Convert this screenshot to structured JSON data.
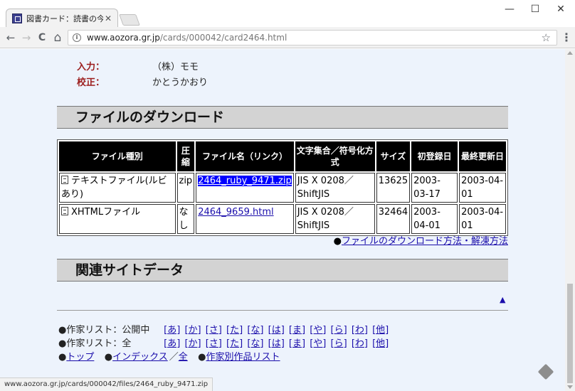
{
  "browser": {
    "tab_title": "図書カード：読書の今昔",
    "tab_close": "✕",
    "url_host": "www.aozora.gr.jp",
    "url_path": "/cards/000042/card2464.html",
    "status_url": "www.aozora.gr.jp/cards/000042/files/2464_ruby_9471.zip",
    "minimize": "—",
    "maximize": "☐",
    "close": "✕",
    "back": "←",
    "forward": "→",
    "reload": "C",
    "home": "⌂",
    "info": "i",
    "star": "☆",
    "menu": "⋮"
  },
  "meta": [
    {
      "label": "入力：",
      "value": "（株）モモ"
    },
    {
      "label": "校正：",
      "value": "かとうかおり"
    }
  ],
  "download_section": {
    "title": "ファイルのダウンロード",
    "headers": {
      "type": "ファイル種別",
      "compress": "圧縮",
      "name": "ファイル名（リンク）",
      "charset": "文字集合／符号化方式",
      "size": "サイズ",
      "first": "初登録日",
      "updated": "最終更新日"
    },
    "rows": [
      {
        "type": "テキストファイル(ルビあり)",
        "compress": "zip",
        "name": "2464_ruby_9471.zip",
        "charset": "JIS X 0208／ShiftJIS",
        "size": "13625",
        "first": "2003-03-17",
        "updated": "2003-04-01"
      },
      {
        "type": "XHTMLファイル",
        "compress": "なし",
        "name": "2464_9659.html",
        "charset": "JIS X 0208／ShiftJIS",
        "size": "32464",
        "first": "2003-04-01",
        "updated": "2003-04-01"
      }
    ],
    "howto_bullet": "●",
    "howto_link": "ファイルのダウンロード方法・解凍方法"
  },
  "related_section": {
    "title": "関連サイトデータ"
  },
  "back_to_top": "▲",
  "footer": {
    "public_label": "●作家リスト：公開中",
    "all_label": "●作家リスト：全",
    "kana": [
      "[あ]",
      "[か]",
      "[さ]",
      "[た]",
      "[な]",
      "[は]",
      "[ま]",
      "[や]",
      "[ら]",
      "[わ]",
      "[他]"
    ],
    "bullet": "●",
    "top": "トップ",
    "index": "インデックス",
    "slash": "／",
    "all": "全",
    "works": "作家別作品リスト"
  }
}
